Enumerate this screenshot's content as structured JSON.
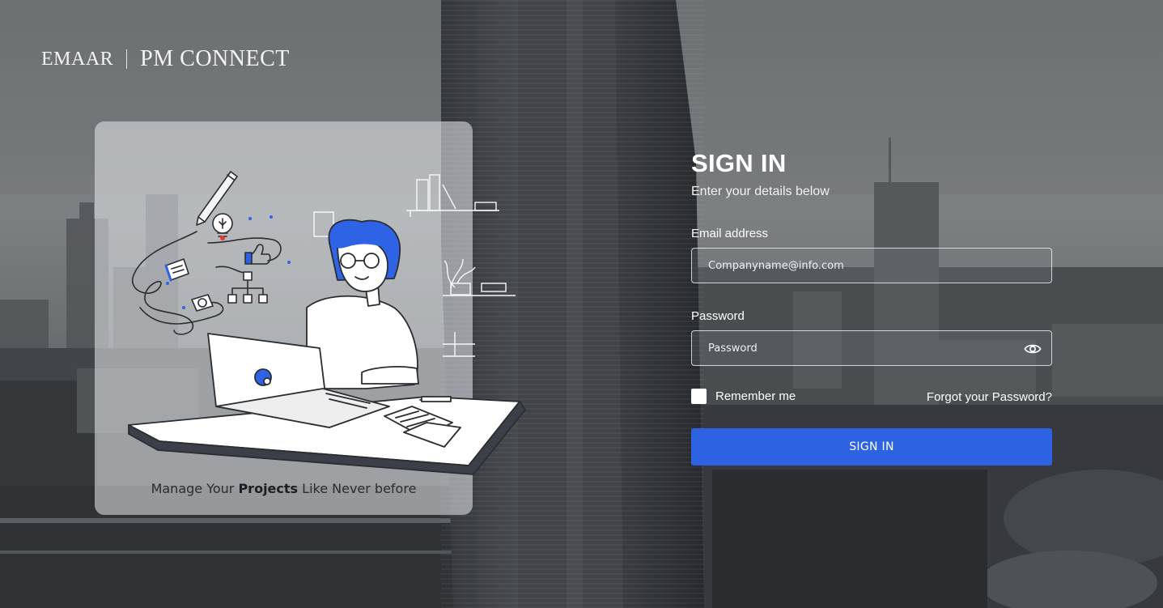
{
  "brand": {
    "company": "EMAAR",
    "product": "PM CONNECT"
  },
  "promo": {
    "tagline_prefix": "Manage Your ",
    "tagline_bold": "Projects",
    "tagline_suffix": " Like Never before"
  },
  "signin": {
    "title": "SIGN IN",
    "subtitle": "Enter your details below",
    "email_label": "Email address",
    "email_placeholder": "Companyname@info.com",
    "email_value": "",
    "password_label": "Password",
    "password_placeholder": "Password",
    "password_value": "",
    "password_toggle_icon": "eye-icon",
    "remember_label": "Remember me",
    "remember_checked": false,
    "forgot_label": "Forgot your Password?",
    "submit_label": "SIGN IN"
  },
  "colors": {
    "accent": "#2d63e2",
    "text": "#ffffff",
    "illustration_blue": "#2f63e6"
  }
}
